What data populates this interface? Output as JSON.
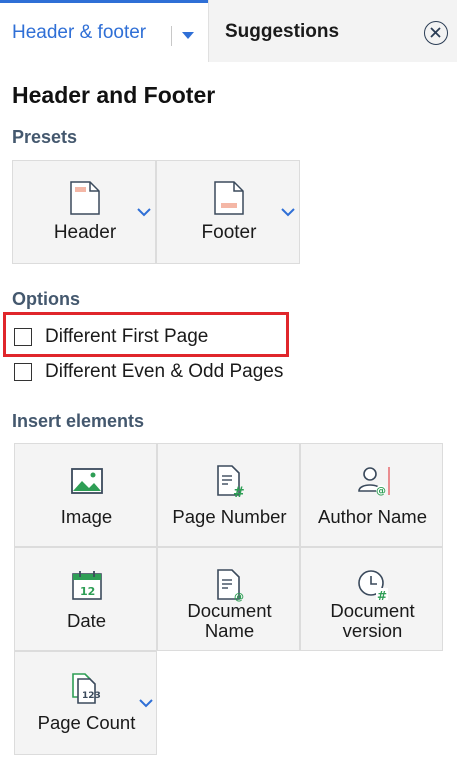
{
  "tabs": {
    "active_label": "Header & footer",
    "inactive_label": "Suggestions"
  },
  "panel": {
    "title": "Header and Footer"
  },
  "presets": {
    "title": "Presets",
    "items": [
      {
        "label": "Header",
        "icon": "header-preset-icon"
      },
      {
        "label": "Footer",
        "icon": "footer-preset-icon"
      }
    ]
  },
  "options": {
    "title": "Options",
    "items": [
      {
        "label": "Different First Page",
        "checked": false
      },
      {
        "label": "Different Even & Odd Pages",
        "checked": false
      }
    ]
  },
  "insert": {
    "title": "Insert elements",
    "items": [
      {
        "label": "Image",
        "icon": "image-icon"
      },
      {
        "label": "Page Number",
        "icon": "page-number-icon"
      },
      {
        "label": "Author Name",
        "icon": "author-name-icon"
      },
      {
        "label": "Date",
        "icon": "date-icon"
      },
      {
        "label_line1": "Document",
        "label_line2": "Name",
        "icon": "document-name-icon"
      },
      {
        "label_line1": "Document",
        "label_line2": "version",
        "icon": "document-version-icon"
      },
      {
        "label": "Page Count",
        "icon": "page-count-icon"
      }
    ]
  },
  "colors": {
    "accent": "#2f6fd6",
    "highlight": "#e0262b",
    "icon_green": "#2e9e55",
    "icon_dark": "#3b4a5c"
  }
}
